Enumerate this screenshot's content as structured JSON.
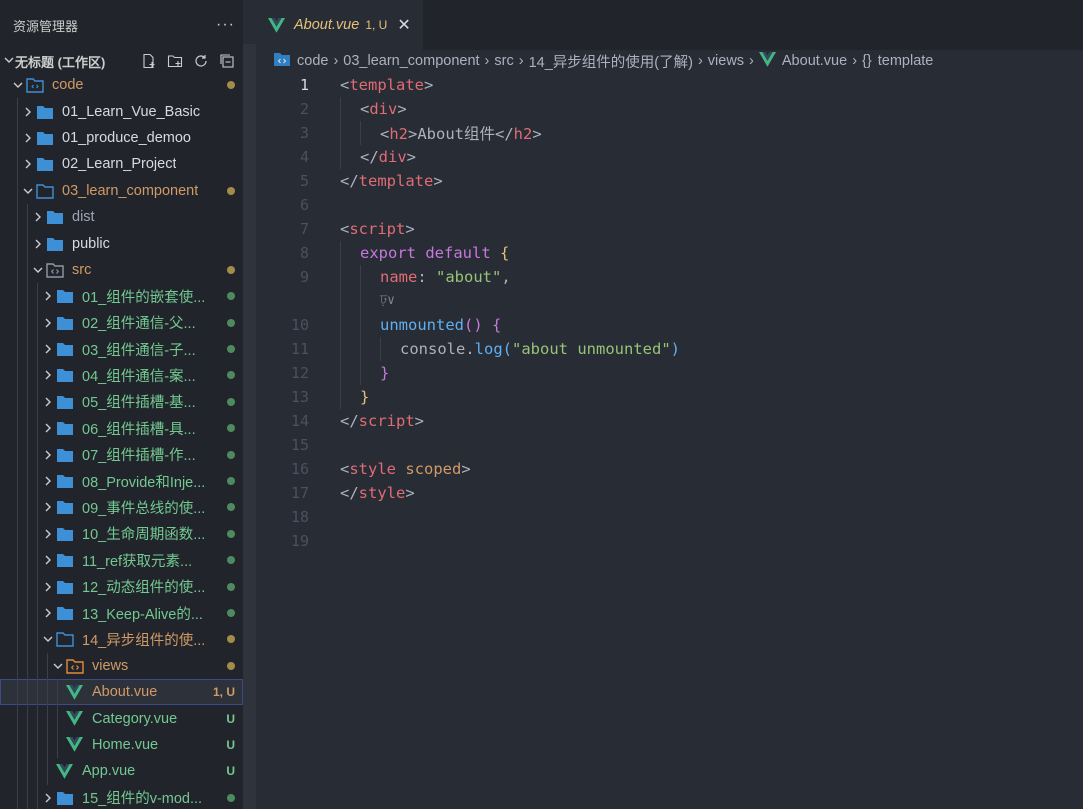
{
  "sidebar": {
    "title": "资源管理器",
    "more": "···",
    "workspace": "无标题 (工作区)",
    "tree": [
      {
        "depth": 0,
        "kind": "root",
        "open": true,
        "name": "code",
        "color": "mod",
        "status": "dot-mod"
      },
      {
        "depth": 1,
        "kind": "folder",
        "open": false,
        "name": "01_Learn_Vue_Basic",
        "color": "norm",
        "status": ""
      },
      {
        "depth": 1,
        "kind": "folder",
        "open": false,
        "name": "01_produce_demoo",
        "color": "norm",
        "status": ""
      },
      {
        "depth": 1,
        "kind": "folder",
        "open": false,
        "name": "02_Learn_Project",
        "color": "norm",
        "status": ""
      },
      {
        "depth": 1,
        "kind": "folder",
        "open": true,
        "name": "03_learn_component",
        "color": "mod",
        "status": "dot-mod"
      },
      {
        "depth": 2,
        "kind": "folder",
        "open": false,
        "name": "dist",
        "color": "dim",
        "status": ""
      },
      {
        "depth": 2,
        "kind": "folder",
        "open": false,
        "name": "public",
        "color": "norm",
        "status": ""
      },
      {
        "depth": 2,
        "kind": "src",
        "open": true,
        "name": "src",
        "color": "mod",
        "status": "dot-mod"
      },
      {
        "depth": 3,
        "kind": "folder",
        "open": false,
        "name": "01_组件的嵌套使...",
        "color": "new",
        "status": "dot-new"
      },
      {
        "depth": 3,
        "kind": "folder",
        "open": false,
        "name": "02_组件通信-父...",
        "color": "new",
        "status": "dot-new"
      },
      {
        "depth": 3,
        "kind": "folder",
        "open": false,
        "name": "03_组件通信-子...",
        "color": "new",
        "status": "dot-new"
      },
      {
        "depth": 3,
        "kind": "folder",
        "open": false,
        "name": "04_组件通信-案...",
        "color": "new",
        "status": "dot-new"
      },
      {
        "depth": 3,
        "kind": "folder",
        "open": false,
        "name": "05_组件插槽-基...",
        "color": "new",
        "status": "dot-new"
      },
      {
        "depth": 3,
        "kind": "folder",
        "open": false,
        "name": "06_组件插槽-具...",
        "color": "new",
        "status": "dot-new"
      },
      {
        "depth": 3,
        "kind": "folder",
        "open": false,
        "name": "07_组件插槽-作...",
        "color": "new",
        "status": "dot-new"
      },
      {
        "depth": 3,
        "kind": "folder",
        "open": false,
        "name": "08_Provide和Inje...",
        "color": "new",
        "status": "dot-new"
      },
      {
        "depth": 3,
        "kind": "folder",
        "open": false,
        "name": "09_事件总线的使...",
        "color": "new",
        "status": "dot-new"
      },
      {
        "depth": 3,
        "kind": "folder",
        "open": false,
        "name": "10_生命周期函数...",
        "color": "new",
        "status": "dot-new"
      },
      {
        "depth": 3,
        "kind": "folder",
        "open": false,
        "name": "11_ref获取元素...",
        "color": "new",
        "status": "dot-new"
      },
      {
        "depth": 3,
        "kind": "folder",
        "open": false,
        "name": "12_动态组件的使...",
        "color": "new",
        "status": "dot-new"
      },
      {
        "depth": 3,
        "kind": "folder",
        "open": false,
        "name": "13_Keep-Alive的...",
        "color": "new",
        "status": "dot-new"
      },
      {
        "depth": 3,
        "kind": "folder",
        "open": true,
        "name": "14_异步组件的使...",
        "color": "mod",
        "status": "dot-mod"
      },
      {
        "depth": 4,
        "kind": "views",
        "open": true,
        "name": "views",
        "color": "mod",
        "status": "dot-mod"
      },
      {
        "depth": 5,
        "kind": "vue",
        "name": "About.vue",
        "color": "mod",
        "status": "1, U",
        "selected": true
      },
      {
        "depth": 5,
        "kind": "vue",
        "name": "Category.vue",
        "color": "new",
        "status": "U"
      },
      {
        "depth": 5,
        "kind": "vue",
        "name": "Home.vue",
        "color": "new",
        "status": "U"
      },
      {
        "depth": 4,
        "kind": "vue",
        "name": "App.vue",
        "color": "new",
        "status": "U"
      },
      {
        "depth": 3,
        "kind": "folder",
        "open": false,
        "name": "15_组件的v-mod...",
        "color": "new",
        "status": "dot-new"
      }
    ]
  },
  "editor": {
    "tab": {
      "label": "About.vue",
      "status": "1, U",
      "close": "✕"
    },
    "breadcrumb": [
      "code",
      "03_learn_component",
      "src",
      "14_异步组件的使用(了解)",
      "views",
      "About.vue",
      "template"
    ],
    "breadcrumb_brace": "{}",
    "hint": "ঢ়∨",
    "active_line": "1",
    "lines": [
      "1",
      "2",
      "3",
      "4",
      "5",
      "6",
      "7",
      "8",
      "9",
      "10",
      "11",
      "12",
      "13",
      "14",
      "15",
      "16",
      "17",
      "18",
      "19"
    ],
    "code": {
      "l1_open": "<",
      "l1_tag": "template",
      "l1_close": ">",
      "l2_open": "<",
      "l2_tag": "div",
      "l2_close": ">",
      "l3_open": "<",
      "l3_tag": "h2",
      "l3_mid": ">About组件</",
      "l3_tag2": "h2",
      "l3_close": ">",
      "l4_open": "</",
      "l4_tag": "div",
      "l4_close": ">",
      "l5_open": "</",
      "l5_tag": "template",
      "l5_close": ">",
      "l7_open": "<",
      "l7_tag": "script",
      "l7_close": ">",
      "l8_kw1": "export",
      "l8_kw2": "default",
      "l8_brace": "{",
      "l9_prop": "name",
      "l9_colon": ":",
      "l9_str": "\"about\"",
      "l9_comma": ",",
      "l10_fn": "unmounted",
      "l10_parens": "()",
      "l10_brace": "{",
      "l11_obj": "console",
      "l11_dot": ".",
      "l11_fn": "log",
      "l11_po": "(",
      "l11_str": "\"about unmounted\"",
      "l11_pc": ")",
      "l12_brace": "}",
      "l13_brace": "}",
      "l14_open": "</",
      "l14_tag": "script",
      "l14_close": ">",
      "l16_open": "<",
      "l16_tag": "style",
      "l16_attr": "scoped",
      "l16_close": ">",
      "l17_open": "</",
      "l17_tag": "style",
      "l17_close": ">"
    }
  },
  "colors": {
    "accent_modified": "#d19a66",
    "accent_untracked": "#73c991",
    "vue_green": "#41b883"
  }
}
